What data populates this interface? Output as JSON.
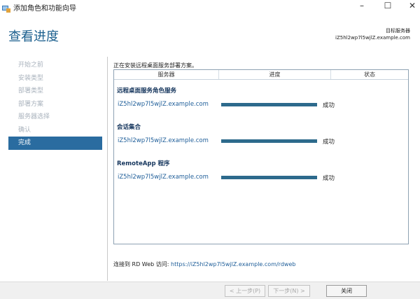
{
  "window": {
    "title": "添加角色和功能向导",
    "controls": {
      "minimize": "–",
      "maximize": "☐",
      "close": "✕"
    }
  },
  "header": {
    "title": "查看进度",
    "target_label": "目标服务器",
    "target_value": "iZ5hl2wp7l5wjlZ.example.com"
  },
  "nav": {
    "items": [
      {
        "label": "开始之前",
        "active": false
      },
      {
        "label": "安装类型",
        "active": false
      },
      {
        "label": "部署类型",
        "active": false
      },
      {
        "label": "部署方案",
        "active": false
      },
      {
        "label": "服务器选择",
        "active": false
      },
      {
        "label": "确认",
        "active": false
      },
      {
        "label": "完成",
        "active": true
      }
    ]
  },
  "main": {
    "status_message": "正在安装远程桌面服务部署方案。",
    "columns": {
      "server": "服务器",
      "progress": "进度",
      "status": "状态"
    },
    "groups": [
      {
        "title": "远程桌面服务角色服务",
        "server": "iZ5hl2wp7l5wjlZ.example.com",
        "progress": 1.0,
        "status": "成功"
      },
      {
        "title": "会话集合",
        "server": "iZ5hl2wp7l5wjlZ.example.com",
        "progress": 1.0,
        "status": "成功"
      },
      {
        "title": "RemoteApp 程序",
        "server": "iZ5hl2wp7l5wjlZ.example.com",
        "progress": 1.0,
        "status": "成功"
      }
    ],
    "footer_text": "连接到 RD Web 访问: ",
    "footer_link": "https://iZ5hl2wp7l5wjlZ.example.com/rdweb"
  },
  "buttons": {
    "previous": "< 上一步(P)",
    "next": "下一步(N) >",
    "close": "关闭"
  },
  "colors": {
    "accent": "#2a6ca0",
    "title": "#1b5f8e",
    "progress": "#2d6a8c"
  }
}
